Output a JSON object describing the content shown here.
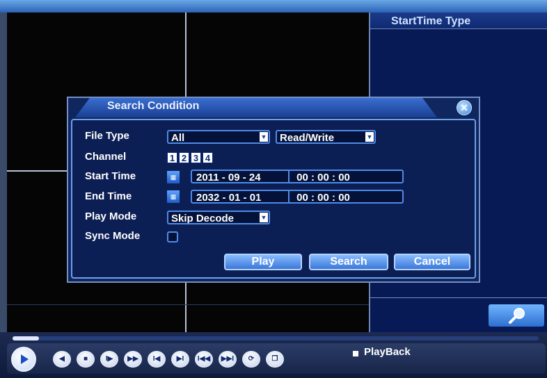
{
  "right_panel": {
    "header": "StartTime Type"
  },
  "dialog": {
    "title": "Search Condition",
    "close_icon": "close-icon",
    "file_type": {
      "label": "File Type",
      "value": "All",
      "rw_value": "Read/Write"
    },
    "channel": {
      "label": "Channel",
      "channels": [
        "1",
        "2",
        "3",
        "4"
      ]
    },
    "start_time": {
      "label": "Start Time",
      "date": "2011 - 09 - 24",
      "time": "00 : 00 : 00"
    },
    "end_time": {
      "label": "End Time",
      "date": "2032 - 01 - 01",
      "time": "00 : 00 : 00"
    },
    "play_mode": {
      "label": "Play Mode",
      "value": "Skip Decode"
    },
    "sync_mode": {
      "label": "Sync Mode",
      "checked": false
    },
    "buttons": {
      "play": "Play",
      "search": "Search",
      "cancel": "Cancel"
    }
  },
  "playback": {
    "label": "PlayBack",
    "progress": 0.05,
    "controls": [
      "play-icon",
      "prev-icon",
      "stop-icon",
      "step-icon",
      "fast-forward-icon",
      "frame-back-icon",
      "frame-forward-icon",
      "skip-back-icon",
      "skip-forward-icon",
      "refresh-icon",
      "window-icon"
    ]
  },
  "colors": {
    "panel_bg": "#071a55",
    "dialog_bg": "#10265f",
    "accent": "#4f8be8",
    "button": "#3b78d8"
  }
}
